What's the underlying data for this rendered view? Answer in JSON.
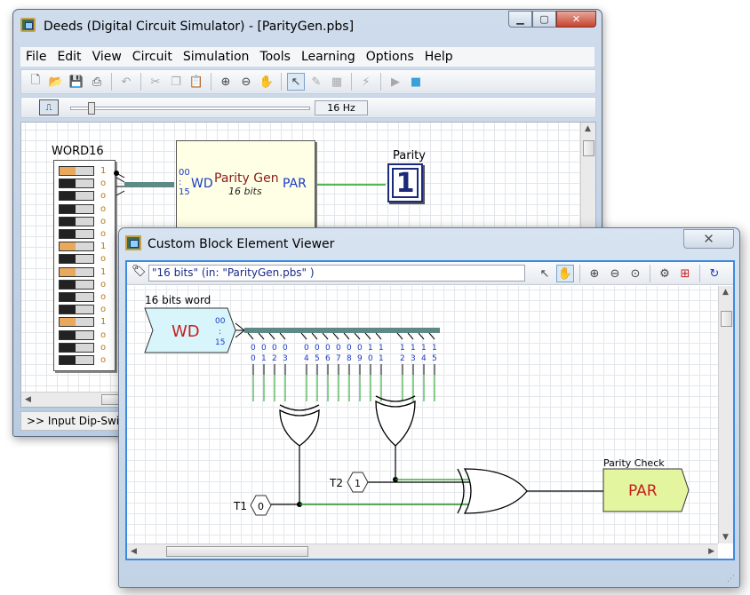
{
  "main_window": {
    "title": "Deeds (Digital Circuit Simulator) - [ParityGen.pbs]",
    "menu": [
      "File",
      "Edit",
      "View",
      "Circuit",
      "Simulation",
      "Tools",
      "Learning",
      "Options",
      "Help"
    ],
    "clock_frequency": "16 Hz",
    "status_text": ">> Input Dip-Switc"
  },
  "circuit": {
    "dip_label": "WORD16",
    "dip_bits": [
      1,
      0,
      0,
      0,
      0,
      0,
      1,
      0,
      1,
      0,
      0,
      0,
      1,
      0,
      0,
      0
    ],
    "block": {
      "name": "Parity Gen",
      "subtitle": "16 bits",
      "in_port": "WD",
      "out_port": "PAR",
      "bus_top": "00",
      "bus_sep": ":",
      "bus_bottom": "15"
    },
    "output_label": "Parity",
    "output_value": "1"
  },
  "viewer": {
    "title": "Custom Block Element Viewer",
    "close": "✕",
    "path": "\"16 bits\"  (in: \"ParityGen.pbs\" )",
    "input_label": "16 bits word",
    "input_name": "WD",
    "bus_top": "00",
    "bus_sep": ":",
    "bus_bottom": "15",
    "bit_labels": [
      [
        "0",
        "0"
      ],
      [
        "0",
        "1"
      ],
      [
        "0",
        "2"
      ],
      [
        "0",
        "3"
      ],
      [
        "0",
        "4"
      ],
      [
        "0",
        "5"
      ],
      [
        "0",
        "6"
      ],
      [
        "0",
        "7"
      ],
      [
        "0",
        "8"
      ],
      [
        "0",
        "9"
      ],
      [
        "1",
        "0"
      ],
      [
        "1",
        "1"
      ],
      [
        "1",
        "2"
      ],
      [
        "1",
        "3"
      ],
      [
        "1",
        "4"
      ],
      [
        "1",
        "5"
      ]
    ],
    "t1_label": "T1",
    "t1_value": "0",
    "t2_label": "T2",
    "t2_value": "1",
    "output_label": "Parity Check",
    "output_name": "PAR"
  },
  "colors": {
    "bus": "#5d8a87",
    "wire_active": "#1aa01a",
    "block_fill": "#ffffe6",
    "input_fill": "#d8f5fc",
    "output_fill": "#e4f5a0",
    "bit_text": "#1a3ac8",
    "label_red": "#c81e1e"
  }
}
